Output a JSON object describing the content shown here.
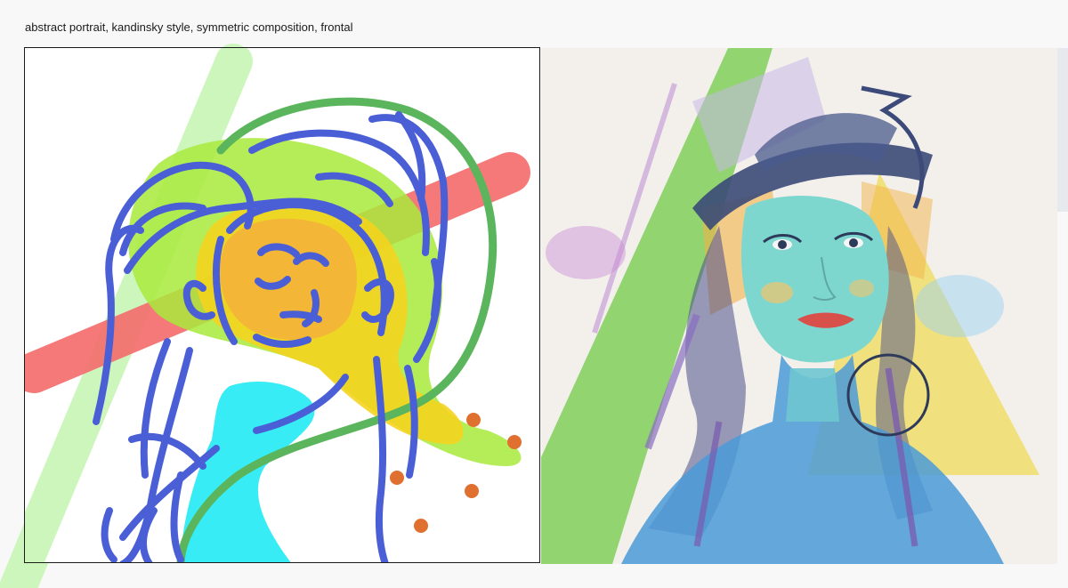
{
  "prompt": {
    "text": "abstract portrait, kandinsky style, symmetric composition, frontal"
  },
  "sketch": {
    "stroke_colors": {
      "blue": "#4a5fd6",
      "green_outline": "#5bb55c",
      "light_green": "#c8f5b5",
      "yellow_green": "#9ee84a",
      "yellow": "#f5d31c",
      "orange": "#f4b33a",
      "red": "#f46e6e",
      "cyan": "#22eaf5",
      "dots": "#e07030"
    }
  },
  "output": {
    "palette": {
      "background": "#f3f0ec",
      "skin": "#7ed7cf",
      "hat": "#3b4a78",
      "green_band": "#7fcf5a",
      "yellow": "#f0d850",
      "lips": "#d8504a",
      "shirt_blue": "#4a9ad8"
    }
  }
}
